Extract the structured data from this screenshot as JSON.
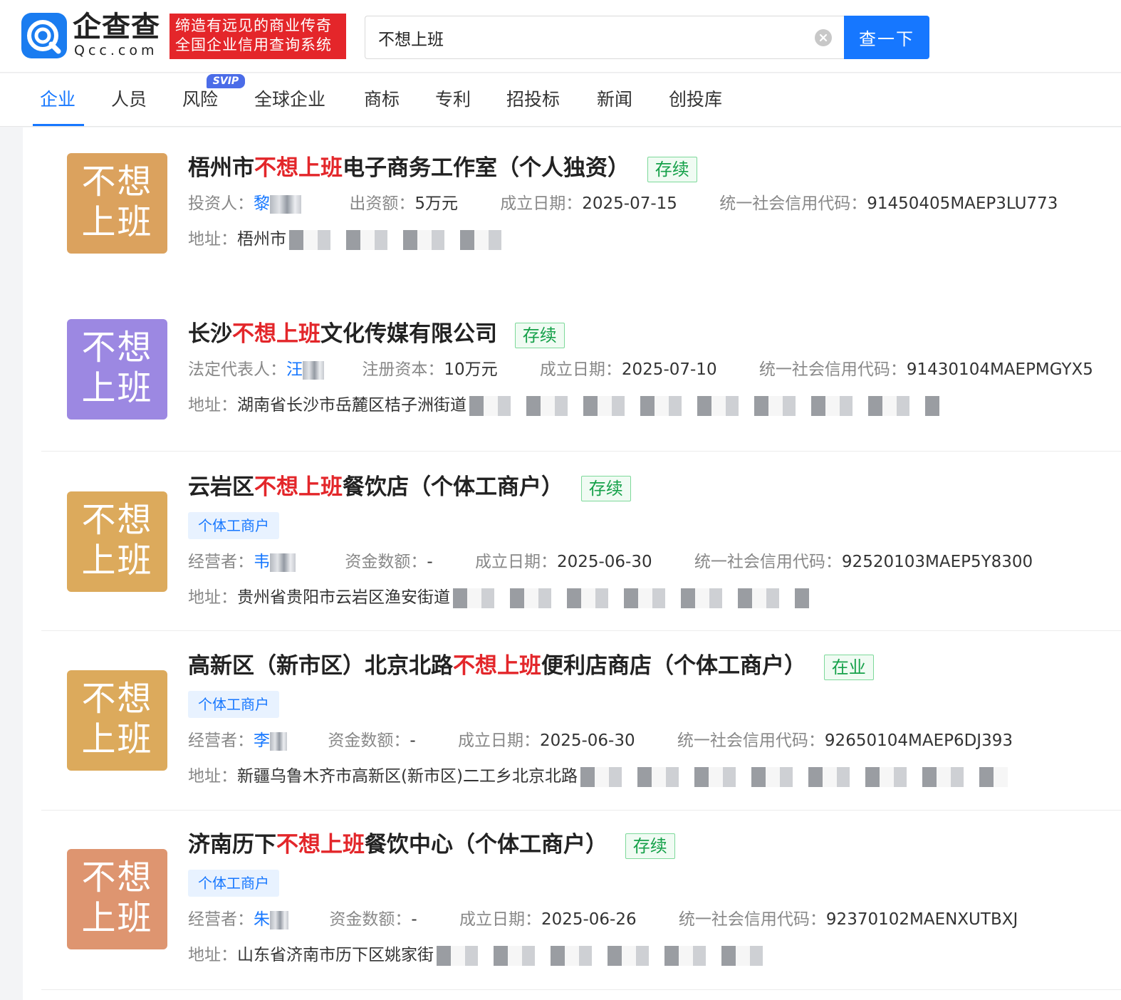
{
  "logo": {
    "name": "企查查",
    "domain": "Qcc.com",
    "slogan_line1": "缔造有远见的商业传奇",
    "slogan_line2": "全国企业信用查询系统"
  },
  "search": {
    "value": "不想上班",
    "button_label": "查一下"
  },
  "tabs": [
    {
      "label": "企业",
      "active": true
    },
    {
      "label": "人员"
    },
    {
      "label": "风险",
      "badge": "SVIP"
    },
    {
      "label": "全球企业"
    },
    {
      "label": "商标"
    },
    {
      "label": "专利"
    },
    {
      "label": "招投标"
    },
    {
      "label": "新闻"
    },
    {
      "label": "创投库"
    }
  ],
  "colors": {
    "primary": "#1677ff",
    "highlight": "#e3262a",
    "status_green": "#16a14a",
    "slogan_red": "#e4262a"
  },
  "results": [
    {
      "thumb_line1": "不想",
      "thumb_line2": "上班",
      "thumb_color": "#dba25e",
      "title_pre": "梧州市",
      "title_hl": "不想上班",
      "title_post": "电子商务工作室（个人独资）",
      "status": "存续",
      "person_label": "投资人：",
      "person_name": "黎",
      "capital_label": "出资额：",
      "capital_value": "5万元",
      "date_label": "成立日期：",
      "date_value": "2025-07-15",
      "code_label": "统一社会信用代码：",
      "code_value": "91450405MAEP3LU773",
      "address_label": "地址：",
      "address_value": "梧州市"
    },
    {
      "thumb_line1": "不想",
      "thumb_line2": "上班",
      "thumb_color": "#9c88e2",
      "title_pre": "长沙",
      "title_hl": "不想上班",
      "title_post": "文化传媒有限公司",
      "status": "存续",
      "person_label": "法定代表人：",
      "person_name": "汪",
      "capital_label": "注册资本：",
      "capital_value": "10万元",
      "date_label": "成立日期：",
      "date_value": "2025-07-10",
      "code_label": "统一社会信用代码：",
      "code_value": "91430104MAEPMGYX5",
      "address_label": "地址：",
      "address_value": "湖南省长沙市岳麓区桔子洲街道"
    },
    {
      "thumb_line1": "不想",
      "thumb_line2": "上班",
      "thumb_color": "#dcaa5c",
      "title_pre": "云岩区",
      "title_hl": "不想上班",
      "title_post": "餐饮店（个体工商户）",
      "status": "存续",
      "type_tag": "个体工商户",
      "person_label": "经营者：",
      "person_name": "韦",
      "capital_label": "资金数额：",
      "capital_value": "-",
      "date_label": "成立日期：",
      "date_value": "2025-06-30",
      "code_label": "统一社会信用代码：",
      "code_value": "92520103MAEP5Y8300",
      "address_label": "地址：",
      "address_value": "贵州省贵阳市云岩区渔安街道"
    },
    {
      "thumb_line1": "不想",
      "thumb_line2": "上班",
      "thumb_color": "#dcaa5c",
      "title_pre": "高新区（新市区）北京北路",
      "title_hl": "不想上班",
      "title_post": "便利店商店（个体工商户）",
      "status": "在业",
      "type_tag": "个体工商户",
      "person_label": "经营者：",
      "person_name": "李",
      "capital_label": "资金数额：",
      "capital_value": "-",
      "date_label": "成立日期：",
      "date_value": "2025-06-30",
      "code_label": "统一社会信用代码：",
      "code_value": "92650104MAEP6DJ393",
      "address_label": "地址：",
      "address_value": "新疆乌鲁木齐市高新区(新市区)二工乡北京北路"
    },
    {
      "thumb_line1": "不想",
      "thumb_line2": "上班",
      "thumb_color": "#de9570",
      "title_pre": "济南历下",
      "title_hl": "不想上班",
      "title_post": "餐饮中心（个体工商户）",
      "status": "存续",
      "type_tag": "个体工商户",
      "person_label": "经营者：",
      "person_name": "朱",
      "capital_label": "资金数额：",
      "capital_value": "-",
      "date_label": "成立日期：",
      "date_value": "2025-06-26",
      "code_label": "统一社会信用代码：",
      "code_value": "92370102MAENXUTBXJ",
      "address_label": "地址：",
      "address_value": "山东省济南市历下区姚家街"
    }
  ]
}
